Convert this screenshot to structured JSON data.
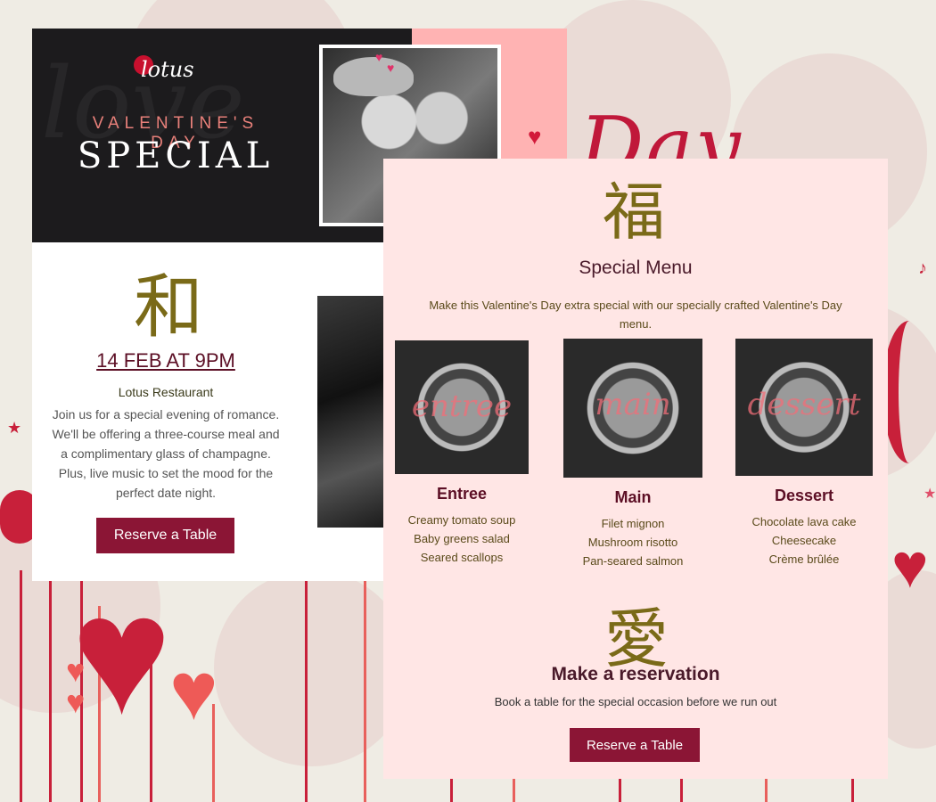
{
  "background": {
    "script_text": "Day"
  },
  "left_card": {
    "logo_text": "lotus",
    "watermark": "love",
    "eyebrow": "VALENTINE'S DAY",
    "title": "SPECIAL",
    "kanji": "和",
    "event_date": "14 FEB AT 9PM",
    "venue": "Lotus Restaurant",
    "description": "Join us for a special evening of romance. We'll be offering a three-course meal and a complimentary glass of champagne. Plus, live music to set the mood for the perfect date night.",
    "reserve_label": "Reserve a Table"
  },
  "right_card": {
    "kanji_top": "福",
    "menu_title": "Special Menu",
    "menu_intro": "Make this Valentine's Day extra special with our specially crafted Valentine's Day menu.",
    "courses": [
      {
        "overlay": "entree",
        "name": "Entree",
        "items": [
          "Creamy tomato soup",
          "Baby greens salad",
          "Seared scallops"
        ]
      },
      {
        "overlay": "main",
        "name": "Main",
        "items": [
          "Filet mignon",
          "Mushroom risotto",
          "Pan-seared salmon"
        ]
      },
      {
        "overlay": "dessert",
        "name": "Dessert",
        "items": [
          "Chocolate lava cake",
          "Cheesecake",
          "Crème brûlée"
        ]
      }
    ],
    "kanji_bottom": "愛",
    "reservation_title": "Make a reservation",
    "reservation_desc": "Book a table for the special occasion before we run out",
    "reserve_label": "Reserve a Table"
  },
  "colors": {
    "accent": "#8b1535",
    "hero_dark": "#1c1b1d",
    "hero_pink": "#ffb3b3",
    "card_pink": "#ffe6e5",
    "kanji_gold": "#7a6a18",
    "heading_wine": "#5c0f25"
  }
}
